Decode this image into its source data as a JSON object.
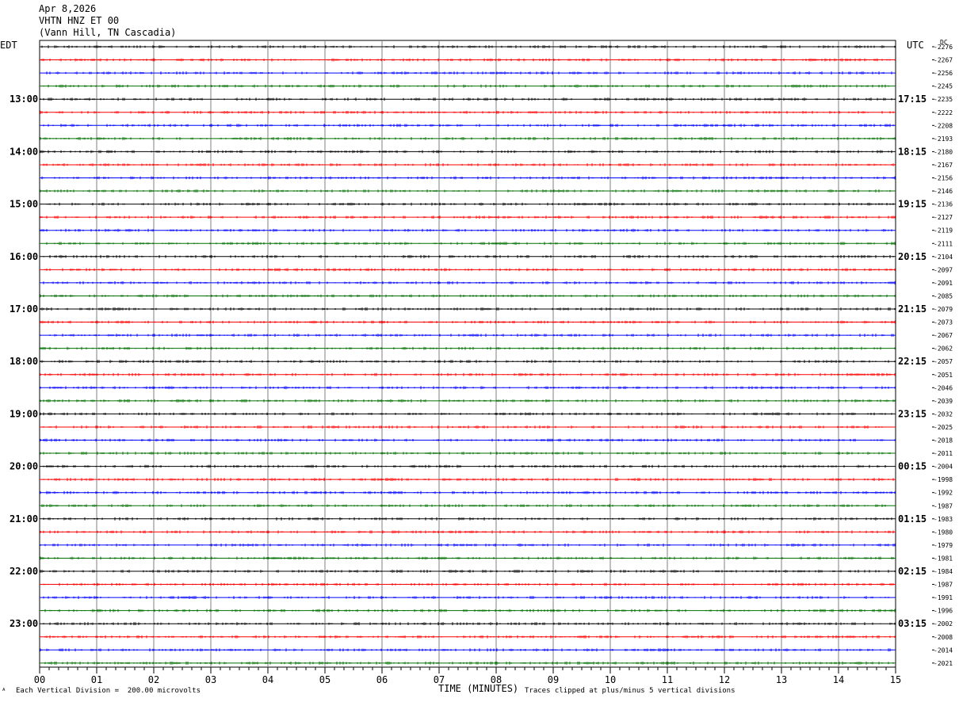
{
  "header": {
    "date": "Apr 8,2026",
    "station": "VHTN HNZ ET 00",
    "location": "(Vann Hill, TN Cascadia)"
  },
  "left_zone": "EDT",
  "right_zone": "UTC",
  "dc_label": "DC",
  "footer": {
    "scale": "Each Vertical Division =  200.00 microvolts",
    "clip": "Traces clipped at plus/minus 5 vertical divisions",
    "xlabel": "TIME (MINUTES)",
    "corner_mark": "ᴬ"
  },
  "colors": {
    "trace_cycle": [
      "#000000",
      "#ff0000",
      "#0000ff",
      "#007000"
    ],
    "grid": "#7f7f7f"
  },
  "chart_data": {
    "type": "line",
    "description_type": "helicorder",
    "x_ticks": [
      "00",
      "01",
      "02",
      "03",
      "04",
      "05",
      "06",
      "07",
      "08",
      "09",
      "10",
      "11",
      "12",
      "13",
      "14",
      "15"
    ],
    "xlim": [
      0,
      15
    ],
    "rows_per_hour": 4,
    "edt_labels": [
      "13:00",
      "14:00",
      "15:00",
      "16:00",
      "17:00",
      "18:00",
      "19:00",
      "20:00",
      "21:00",
      "22:00",
      "23:00"
    ],
    "utc_labels": [
      "17:15",
      "18:15",
      "19:15",
      "20:15",
      "21:15",
      "22:15",
      "23:15",
      "00:15",
      "01:15",
      "02:15",
      "03:15"
    ],
    "first_labeled_row": 4,
    "dc_offsets": [
      "2276",
      "2267",
      "2256",
      "2245",
      "2235",
      "2222",
      "2208",
      "2193",
      "2180",
      "2167",
      "2156",
      "2146",
      "2136",
      "2127",
      "2119",
      "2111",
      "2104",
      "2097",
      "2091",
      "2085",
      "2079",
      "2073",
      "2067",
      "2062",
      "2057",
      "2051",
      "2046",
      "2039",
      "2032",
      "2025",
      "2018",
      "2011",
      "2004",
      "1998",
      "1992",
      "1987",
      "1983",
      "1980",
      "1979",
      "1981",
      "1984",
      "1987",
      "1991",
      "1996",
      "2002",
      "2008",
      "2014",
      "2021"
    ]
  }
}
